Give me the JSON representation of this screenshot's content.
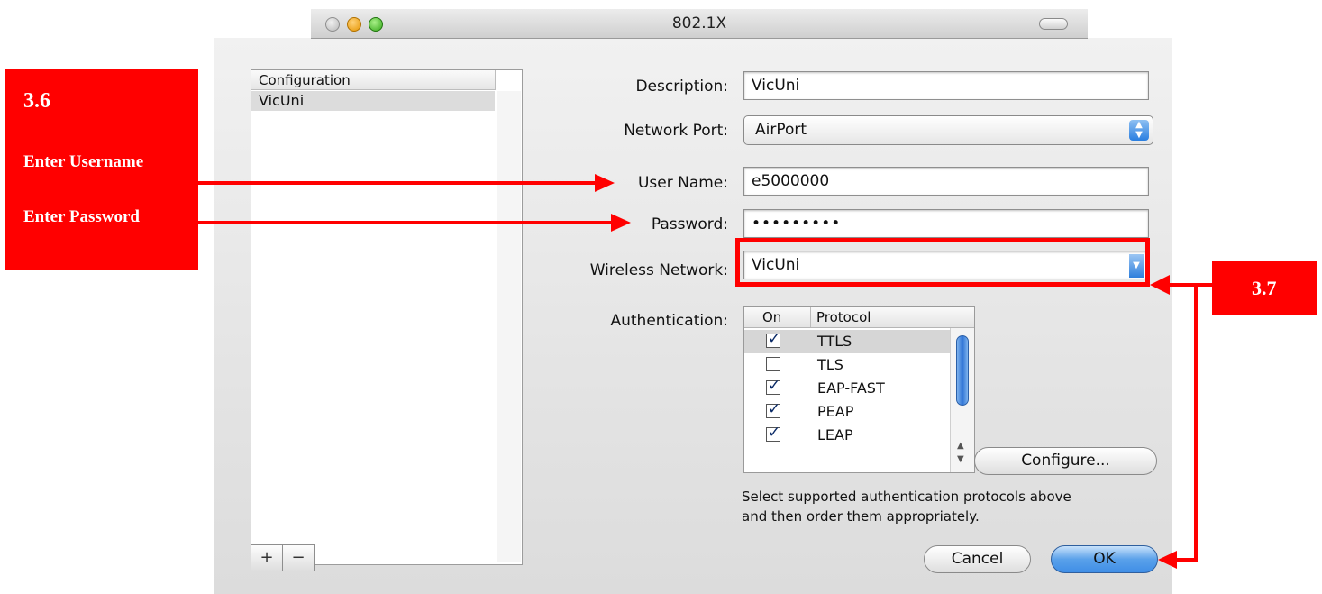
{
  "window": {
    "title": "802.1X"
  },
  "config_list": {
    "header": "Configuration",
    "items": [
      "VicUni"
    ],
    "add_label": "+",
    "remove_label": "−"
  },
  "form": {
    "description_label": "Description:",
    "description_value": "VicUni",
    "network_port_label": "Network Port:",
    "network_port_value": "AirPort",
    "username_label": "User Name:",
    "username_value": "e5000000",
    "password_label": "Password:",
    "password_value": "•••••••••",
    "wireless_label": "Wireless Network:",
    "wireless_value": "VicUni",
    "auth_label": "Authentication:"
  },
  "auth_table": {
    "col_on": "On",
    "col_protocol": "Protocol",
    "rows": [
      {
        "name": "TTLS",
        "checked": true,
        "selected": true
      },
      {
        "name": "TLS",
        "checked": false,
        "selected": false
      },
      {
        "name": "EAP-FAST",
        "checked": true,
        "selected": false
      },
      {
        "name": "PEAP",
        "checked": true,
        "selected": false
      },
      {
        "name": "LEAP",
        "checked": true,
        "selected": false
      }
    ]
  },
  "buttons": {
    "configure": "Configure...",
    "cancel": "Cancel",
    "ok": "OK"
  },
  "help_line1": "Select supported authentication protocols above",
  "help_line2": "and then order them appropriately.",
  "annotations": {
    "step1_number": "3.6",
    "step1_username": "Enter Username",
    "step1_password": "Enter Password",
    "step2_number": "3.7"
  },
  "colors": {
    "annotation": "#ff0000",
    "ok_button": "#3f8ee6"
  }
}
